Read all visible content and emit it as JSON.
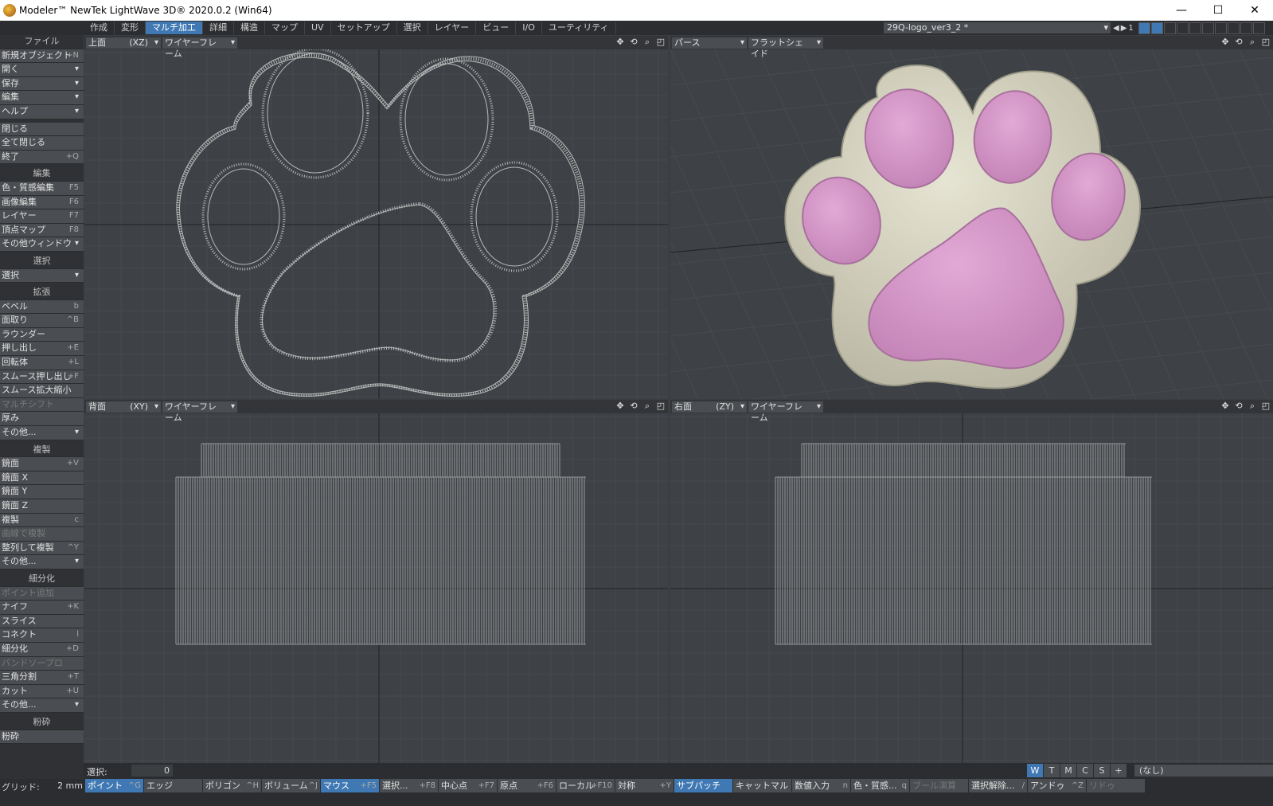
{
  "titlebar": {
    "title": "Modeler™ NewTek LightWave 3D® 2020.0.2 (Win64)",
    "minimize": "—",
    "maximize": "☐",
    "close": "✕"
  },
  "tabs": [
    "作成",
    "変形",
    "マルチ加工",
    "詳細",
    "構造",
    "マップ",
    "UV",
    "セットアップ",
    "選択",
    "レイヤー",
    "ビュー",
    "I/O",
    "ユーティリティ"
  ],
  "active_tab": 2,
  "object": {
    "name": "29Q-logo_ver3_2 *",
    "layer_num": "1"
  },
  "sidebar": [
    {
      "t": "header",
      "label": "ファイル"
    },
    {
      "t": "item",
      "label": "新規オブジェクト",
      "sc": "+N"
    },
    {
      "t": "item",
      "label": "開く",
      "dd": "▾"
    },
    {
      "t": "item",
      "label": "保存",
      "dd": "▾"
    },
    {
      "t": "item",
      "label": "編集",
      "dd": "▾"
    },
    {
      "t": "item",
      "label": "ヘルプ",
      "dd": "▾"
    },
    {
      "t": "gap"
    },
    {
      "t": "item",
      "label": "閉じる"
    },
    {
      "t": "item",
      "label": "全て閉じる"
    },
    {
      "t": "item",
      "label": "終了",
      "sc": "+Q"
    },
    {
      "t": "gap"
    },
    {
      "t": "header",
      "label": "編集"
    },
    {
      "t": "item",
      "label": "色・質感編集",
      "sc": "F5"
    },
    {
      "t": "item",
      "label": "画像編集",
      "sc": "F6"
    },
    {
      "t": "item",
      "label": "レイヤー",
      "sc": "F7"
    },
    {
      "t": "item",
      "label": "頂点マップ",
      "sc": "F8"
    },
    {
      "t": "item",
      "label": "その他ウィンドウ",
      "dd": "▾"
    },
    {
      "t": "gap"
    },
    {
      "t": "header",
      "label": "選択"
    },
    {
      "t": "item",
      "label": "選択",
      "dd": "▾"
    },
    {
      "t": "gap"
    },
    {
      "t": "header",
      "label": "拡張"
    },
    {
      "t": "item",
      "label": "ベベル",
      "sc": "b"
    },
    {
      "t": "item",
      "label": "面取り",
      "sc": "^B"
    },
    {
      "t": "item",
      "label": "ラウンダー"
    },
    {
      "t": "item",
      "label": "押し出し",
      "sc": "+E"
    },
    {
      "t": "item",
      "label": "回転体",
      "sc": "+L"
    },
    {
      "t": "item",
      "label": "スムース押し出し",
      "sc": "+F"
    },
    {
      "t": "item",
      "label": "スムース拡大縮小"
    },
    {
      "t": "dis",
      "label": "マルチシフト"
    },
    {
      "t": "item",
      "label": "厚み"
    },
    {
      "t": "item",
      "label": "その他...",
      "dd": "▾"
    },
    {
      "t": "gap"
    },
    {
      "t": "header",
      "label": "複製"
    },
    {
      "t": "item",
      "label": "鏡面",
      "sc": "+V"
    },
    {
      "t": "item",
      "label": "鏡面 X"
    },
    {
      "t": "item",
      "label": "鏡面 Y"
    },
    {
      "t": "item",
      "label": "鏡面 Z"
    },
    {
      "t": "item",
      "label": "複製",
      "sc": "c"
    },
    {
      "t": "dis",
      "label": "曲線で複製"
    },
    {
      "t": "item",
      "label": "整列して複製",
      "sc": "^Y"
    },
    {
      "t": "item",
      "label": "その他...",
      "dd": "▾"
    },
    {
      "t": "gap"
    },
    {
      "t": "header",
      "label": "細分化"
    },
    {
      "t": "dis",
      "label": "ポイント追加"
    },
    {
      "t": "item",
      "label": "ナイフ",
      "sc": "+K"
    },
    {
      "t": "item",
      "label": "スライス"
    },
    {
      "t": "item",
      "label": "コネクト",
      "sc": "l"
    },
    {
      "t": "item",
      "label": "細分化",
      "sc": "+D"
    },
    {
      "t": "dis",
      "label": "バンドソープロ"
    },
    {
      "t": "item",
      "label": "三角分割",
      "sc": "+T"
    },
    {
      "t": "item",
      "label": "カット",
      "sc": "+U"
    },
    {
      "t": "item",
      "label": "その他...",
      "dd": "▾"
    },
    {
      "t": "gap"
    },
    {
      "t": "header",
      "label": "粉砕"
    },
    {
      "t": "item",
      "label": "粉砕"
    }
  ],
  "viewports": [
    {
      "view": "上面",
      "axis": "(XZ)",
      "mode": "ワイヤーフレーム",
      "axis_h": "X",
      "axis_v": "Z"
    },
    {
      "view": "パース",
      "axis": "",
      "mode": "フラットシェイド"
    },
    {
      "view": "背面",
      "axis": "(XY)",
      "mode": "ワイヤーフレーム",
      "axis_h": "X",
      "axis_v": "Y"
    },
    {
      "view": "右面",
      "axis": "(ZY)",
      "mode": "ワイヤーフレーム",
      "axis_h": "Z",
      "axis_v": "Y"
    }
  ],
  "icons": [
    "move-icon",
    "rotate-icon",
    "zoom-icon",
    "maximize-icon"
  ],
  "colors": {
    "pad": "#d49bc8",
    "body": "#d8d6c2",
    "grid": "#4a4e53",
    "accent": "#3f78b3"
  },
  "status": {
    "select_label": "選択:",
    "select_count": "0",
    "wtmcs": [
      "W",
      "T",
      "M",
      "C",
      "S",
      "+"
    ],
    "surface": "(なし)"
  },
  "bottom": {
    "grid_label": "グリッド:",
    "grid_val": "2 mm",
    "buttons": [
      {
        "l": "ポイント",
        "k": "^G",
        "on": true
      },
      {
        "l": "エッジ",
        "k": ""
      },
      {
        "l": "ポリゴン",
        "k": "^H"
      },
      {
        "l": "ボリューム",
        "k": "^J"
      },
      {
        "l": "マウス",
        "k": "+F5",
        "on": true
      },
      {
        "l": "選択...",
        "k": "+F8"
      },
      {
        "l": "中心点",
        "k": "+F7"
      },
      {
        "l": "原点",
        "k": "+F6"
      },
      {
        "l": "ローカル",
        "k": "+F10"
      },
      {
        "l": "対称",
        "k": "+Y"
      },
      {
        "l": "サブパッチ",
        "k": "",
        "on": true
      },
      {
        "l": "キャットマル",
        "k": ""
      },
      {
        "l": "数値入力",
        "k": "n"
      },
      {
        "l": "色・質感...",
        "k": "q"
      },
      {
        "l": "ブール演算",
        "k": "",
        "dis": true
      },
      {
        "l": "選択解除...",
        "k": "/"
      },
      {
        "l": "アンドゥ",
        "k": "^Z"
      },
      {
        "l": "リドゥ",
        "k": "",
        "dis": true
      }
    ]
  }
}
